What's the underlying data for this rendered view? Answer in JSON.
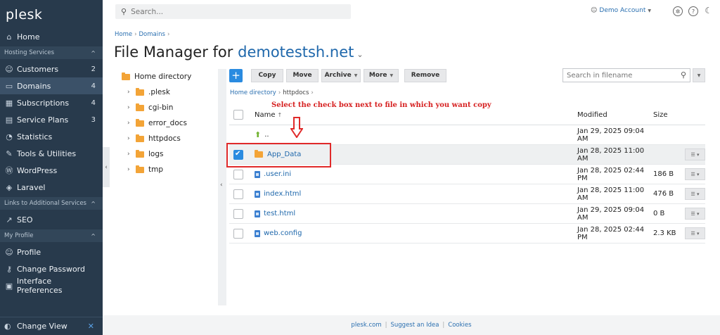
{
  "logo": "plesk",
  "sidebar": {
    "home": "Home",
    "hosting_section": "Hosting Services",
    "items": [
      {
        "label": "Customers",
        "count": "2"
      },
      {
        "label": "Domains",
        "count": "4"
      },
      {
        "label": "Subscriptions",
        "count": "4"
      },
      {
        "label": "Service Plans",
        "count": "3"
      },
      {
        "label": "Statistics",
        "count": ""
      },
      {
        "label": "Tools & Utilities",
        "count": ""
      },
      {
        "label": "WordPress",
        "count": ""
      },
      {
        "label": "Laravel",
        "count": ""
      }
    ],
    "links_section": "Links to Additional Services",
    "seo": "SEO",
    "profile_section": "My Profile",
    "profile_items": [
      "Profile",
      "Change Password",
      "Interface Preferences"
    ],
    "change_view": "Change View"
  },
  "topbar": {
    "search_placeholder": "Search...",
    "account": "Demo Account"
  },
  "breadcrumb": [
    "Home",
    "Domains"
  ],
  "title": {
    "prefix": "File Manager for",
    "domain": "demotestsh.net"
  },
  "tree": {
    "root": "Home directory",
    "children": [
      ".plesk",
      "cgi-bin",
      "error_docs",
      "httpdocs",
      "logs",
      "tmp"
    ]
  },
  "toolbar": {
    "add": "+",
    "copy": "Copy",
    "move": "Move",
    "archive": "Archive",
    "more": "More",
    "remove": "Remove",
    "search_placeholder": "Search in filename"
  },
  "path": {
    "root": "Home directory",
    "current": "httpdocs"
  },
  "annotation": "Select the check box next to file in which you want copy",
  "table": {
    "headers": {
      "name": "Name",
      "modified": "Modified",
      "size": "Size"
    },
    "rows": [
      {
        "name": "..",
        "modified": "Jan 29, 2025 09:04 AM",
        "size": "",
        "type": "up"
      },
      {
        "name": "App_Data",
        "modified": "Jan 28, 2025 11:00 AM",
        "size": "",
        "type": "folder"
      },
      {
        "name": ".user.ini",
        "modified": "Jan 28, 2025 02:44 PM",
        "size": "186 B",
        "type": "file"
      },
      {
        "name": "index.html",
        "modified": "Jan 28, 2025 11:00 AM",
        "size": "476 B",
        "type": "file"
      },
      {
        "name": "test.html",
        "modified": "Jan 29, 2025 09:04 AM",
        "size": "0 B",
        "type": "file"
      },
      {
        "name": "web.config",
        "modified": "Jan 28, 2025 02:44 PM",
        "size": "2.3 KB",
        "type": "file"
      }
    ]
  },
  "footer": [
    "plesk.com",
    "Suggest an Idea",
    "Cookies"
  ]
}
